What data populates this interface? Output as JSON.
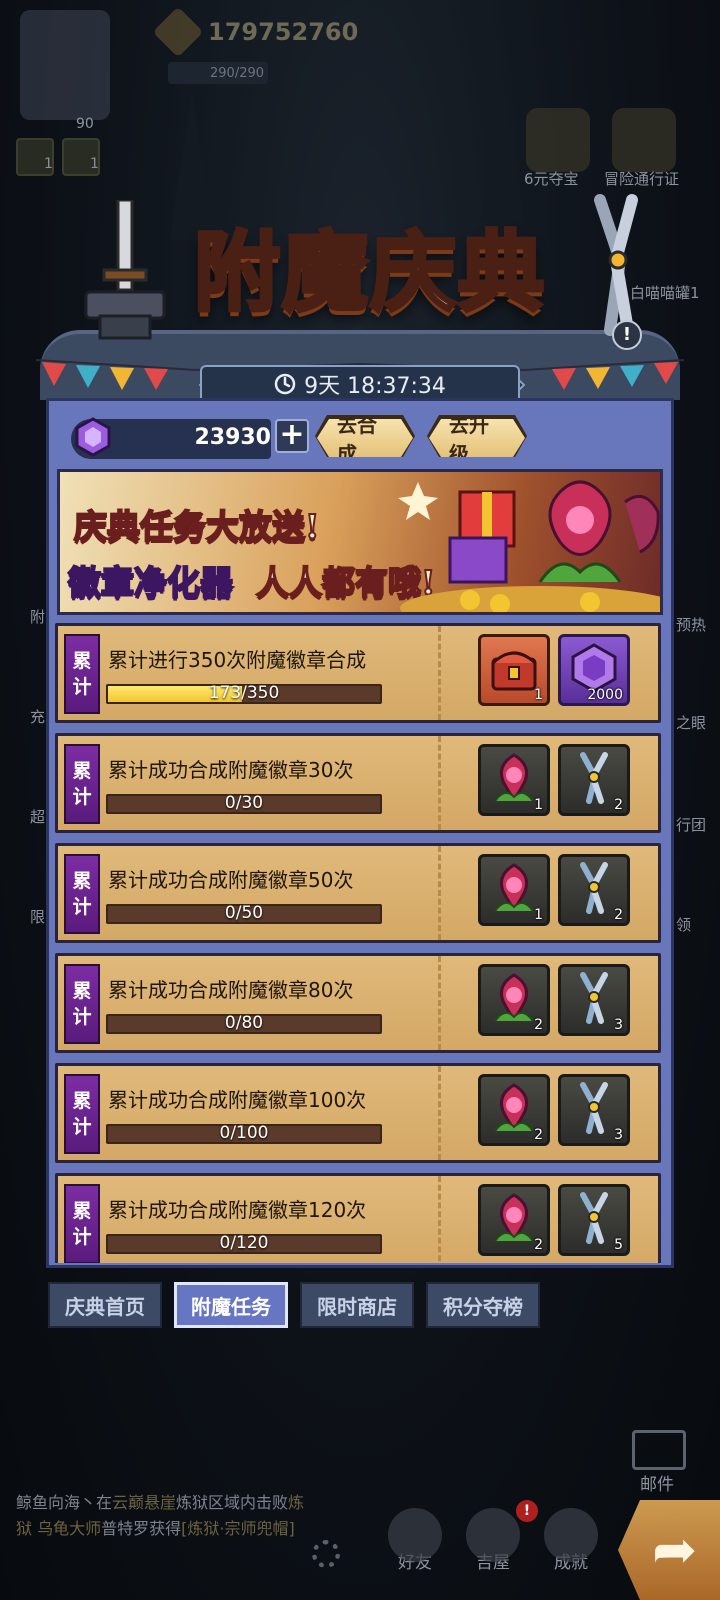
{
  "hud": {
    "coins": "179752760",
    "energy": "290/290",
    "player_level": "90",
    "buff_counts": [
      "1",
      "1"
    ]
  },
  "side_left": [
    "充",
    "超",
    "限",
    "附"
  ],
  "side_right": {
    "top_labels": [
      "6元夺宝",
      "冒险通行证",
      "白喵喵罐1"
    ],
    "labels": [
      "预热",
      "之眼",
      "行团",
      "领"
    ]
  },
  "event": {
    "title": "附魔庆典",
    "timer": "9天 18:37:34",
    "help": "!"
  },
  "currency": {
    "gem_amount": "23930",
    "plus": "+",
    "go_synth": "去合成",
    "go_upgrade": "去升级"
  },
  "promo": {
    "line1": "庆典任务大放送!",
    "line2_a": "徽章净化器",
    "line2_b": "人人都有哦!"
  },
  "tasks": [
    {
      "tag": [
        "累",
        "计"
      ],
      "title": "累计进行350次附魔徽章合成",
      "progress": "173/350",
      "fraction": 0.494,
      "rewards": [
        {
          "icon": "chest-icon",
          "style": "red",
          "count": "1"
        },
        {
          "icon": "gem-icon",
          "style": "purple",
          "count": "2000"
        }
      ]
    },
    {
      "tag": [
        "累",
        "计"
      ],
      "title": "累计成功合成附魔徽章30次",
      "progress": "0/30",
      "fraction": 0,
      "rewards": [
        {
          "icon": "badge-purifier-icon",
          "style": "dark",
          "count": "1"
        },
        {
          "icon": "pliers-icon",
          "style": "dark",
          "count": "2"
        }
      ]
    },
    {
      "tag": [
        "累",
        "计"
      ],
      "title": "累计成功合成附魔徽章50次",
      "progress": "0/50",
      "fraction": 0,
      "rewards": [
        {
          "icon": "badge-purifier-icon",
          "style": "dark",
          "count": "1"
        },
        {
          "icon": "pliers-icon",
          "style": "dark",
          "count": "2"
        }
      ]
    },
    {
      "tag": [
        "累",
        "计"
      ],
      "title": "累计成功合成附魔徽章80次",
      "progress": "0/80",
      "fraction": 0,
      "rewards": [
        {
          "icon": "badge-purifier-icon",
          "style": "dark",
          "count": "2"
        },
        {
          "icon": "pliers-icon",
          "style": "dark",
          "count": "3"
        }
      ]
    },
    {
      "tag": [
        "累",
        "计"
      ],
      "title": "累计成功合成附魔徽章100次",
      "progress": "0/100",
      "fraction": 0,
      "rewards": [
        {
          "icon": "badge-purifier-icon",
          "style": "dark",
          "count": "2"
        },
        {
          "icon": "pliers-icon",
          "style": "dark",
          "count": "3"
        }
      ]
    },
    {
      "tag": [
        "累",
        "计"
      ],
      "title": "累计成功合成附魔徽章120次",
      "progress": "0/120",
      "fraction": 0,
      "rewards": [
        {
          "icon": "badge-purifier-icon",
          "style": "dark",
          "count": "2"
        },
        {
          "icon": "pliers-icon",
          "style": "dark",
          "count": "5"
        }
      ]
    }
  ],
  "tabs": [
    {
      "label": "庆典首页",
      "active": false
    },
    {
      "label": "附魔任务",
      "active": true
    },
    {
      "label": "限时商店",
      "active": false
    },
    {
      "label": "积分夺榜",
      "active": false
    }
  ],
  "chat": {
    "part1": "鲸鱼向海丶在",
    "place": "云巅悬崖",
    "part2": "炼狱区域内击败",
    "mode": "炼狱",
    "boss": "乌龟大师",
    "part3": "普特罗获得",
    "item": "[炼狱·宗师兜帽]"
  },
  "bottom_nav": {
    "mail": "邮件",
    "friends": "好友",
    "shop": "吉屋",
    "achievements": "成就"
  },
  "colors": {
    "panel": "#6877bb",
    "task_bg": "#d9b06f",
    "tag_purple": "#6a239a",
    "progress_fill": "#f2c531",
    "tab_active": "#6776c2"
  }
}
